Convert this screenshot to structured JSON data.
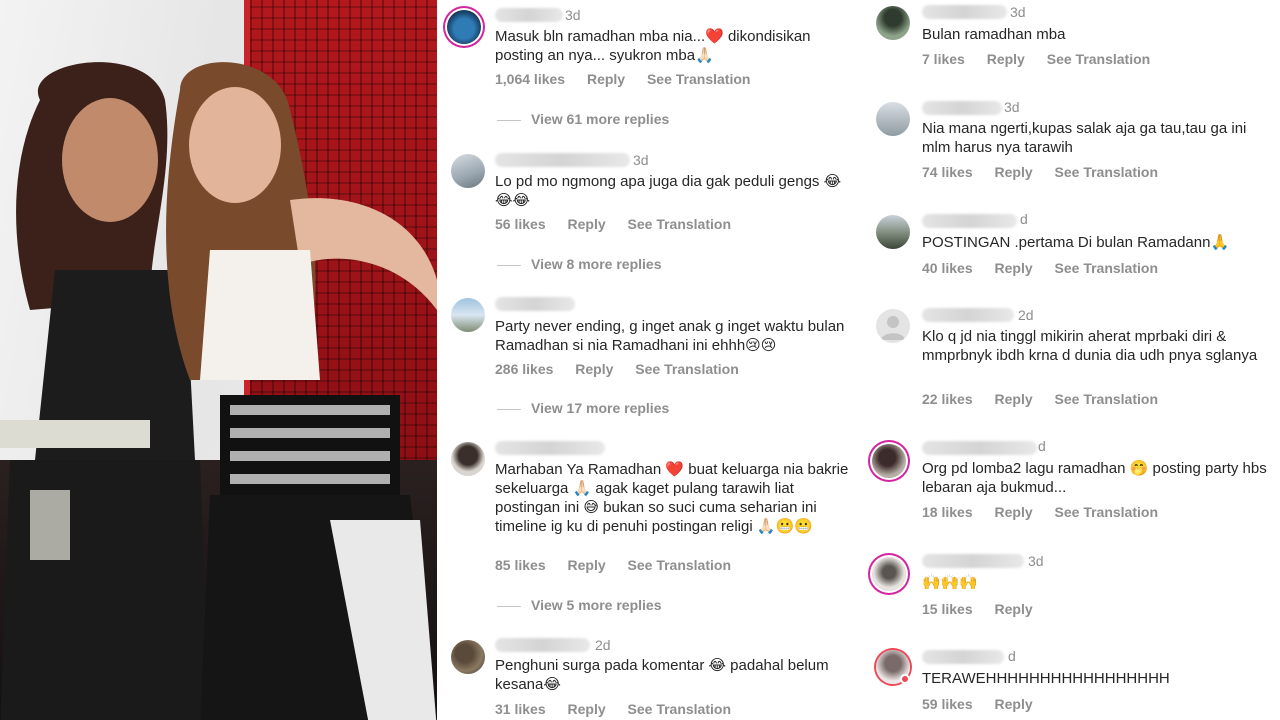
{
  "photo": {
    "alt": "photo"
  },
  "left_comments": [
    {
      "time": "3d",
      "text": "Masuk bln ramadhan mba nia...❤️ dikondisikan posting an nya... syukron mba🙏🏻",
      "likes": "1,064 likes",
      "reply": "Reply",
      "translate": "See Translation",
      "view_replies": "View 61 more replies"
    },
    {
      "time": "3d",
      "text": "Lo pd mo ngmong apa juga dia gak peduli gengs 😂😂😂",
      "likes": "56 likes",
      "reply": "Reply",
      "translate": "See Translation",
      "view_replies": "View 8 more replies"
    },
    {
      "time": "",
      "text": "Party never ending, g inget anak g inget waktu bulan Ramadhan si nia Ramadhani ini ehhh😢😢",
      "likes": "286 likes",
      "reply": "Reply",
      "translate": "See Translation",
      "view_replies": "View 17 more replies"
    },
    {
      "time": "",
      "text": "Marhaban Ya Ramadhan ❤️ buat keluarga nia bakrie sekeluarga 🙏🏻 agak kaget pulang tarawih liat postingan ini 😅 bukan so suci cuma seharian ini  timeline ig ku di penuhi postingan religi 🙏🏻😬😬",
      "likes": "85 likes",
      "reply": "Reply",
      "translate": "See Translation",
      "view_replies": "View 5 more replies"
    },
    {
      "time": "2d",
      "text": "Penghuni surga pada komentar 😂 padahal belum kesana😂",
      "likes": "31 likes",
      "reply": "Reply",
      "translate": "See Translation"
    }
  ],
  "right_comments": [
    {
      "time": "3d",
      "text": "Bulan ramadhan mba",
      "likes": "7 likes",
      "reply": "Reply",
      "translate": "See Translation"
    },
    {
      "time": "3d",
      "text": "Nia mana ngerti,kupas salak aja ga tau,tau ga ini mlm harus nya tarawih",
      "likes": "74 likes",
      "reply": "Reply",
      "translate": "See Translation"
    },
    {
      "time": "d",
      "text": "POSTINGAN .pertama Di bulan Ramadann🙏",
      "likes": "40 likes",
      "reply": "Reply",
      "translate": "See Translation"
    },
    {
      "time": "2d",
      "text": "Klo q jd nia tinggl mikirin aherat mprbaki diri & mmprbnyk ibdh krna d dunia dia udh pnya sglanya",
      "likes": "22 likes",
      "reply": "Reply",
      "translate": "See Translation"
    },
    {
      "time": "d",
      "text": "Org pd lomba2 lagu ramadhan 🤭 posting party hbs lebaran aja bukmud...",
      "likes": "18 likes",
      "reply": "Reply",
      "translate": "See Translation"
    },
    {
      "time": "3d",
      "text": "🙌🙌🙌",
      "likes": "15 likes",
      "reply": "Reply"
    },
    {
      "time": "d",
      "text": "TERAWEHHHHHHHHHHHHHHHHH",
      "likes": "59 likes",
      "reply": "Reply"
    }
  ]
}
